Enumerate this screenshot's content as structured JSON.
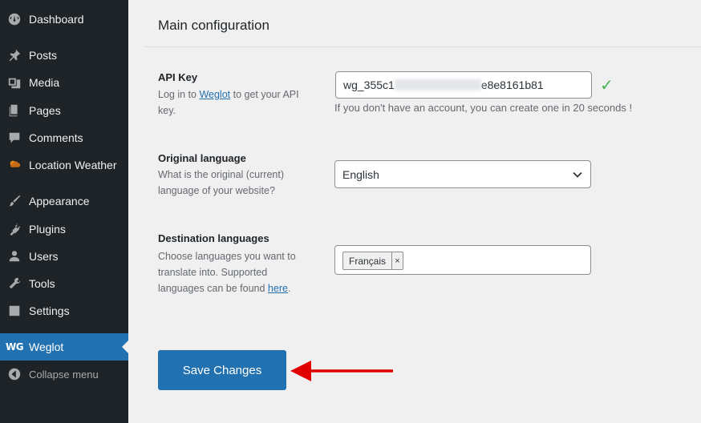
{
  "sidebar": {
    "items": [
      {
        "label": "Dashboard",
        "icon": "dashboard-icon"
      },
      {
        "label": "Posts",
        "icon": "pushpin-icon"
      },
      {
        "label": "Media",
        "icon": "media-icon"
      },
      {
        "label": "Pages",
        "icon": "pages-icon"
      },
      {
        "label": "Comments",
        "icon": "comment-icon"
      },
      {
        "label": "Location Weather",
        "icon": "weather-icon"
      },
      {
        "label": "Appearance",
        "icon": "paintbrush-icon"
      },
      {
        "label": "Plugins",
        "icon": "plugin-icon"
      },
      {
        "label": "Users",
        "icon": "users-icon"
      },
      {
        "label": "Tools",
        "icon": "wrench-icon"
      },
      {
        "label": "Settings",
        "icon": "settings-icon"
      },
      {
        "label": "Weglot",
        "icon": "weglot-logo-icon",
        "logo_text": "WG",
        "active": true
      },
      {
        "label": "Collapse menu",
        "icon": "collapse-icon"
      }
    ]
  },
  "main": {
    "title": "Main configuration",
    "api_key": {
      "label": "API Key",
      "desc_before": "Log in to ",
      "desc_link": "Weglot",
      "desc_after": " to get your API key.",
      "value_start": "wg_355c1",
      "value_end": "e8e8161b81",
      "hint": "If you don't have an account, you can create one in 20 seconds !"
    },
    "original_language": {
      "label": "Original language",
      "desc": "What is the original (current) language of your website?",
      "selected": "English"
    },
    "destination_languages": {
      "label": "Destination languages",
      "desc_before": "Choose languages you want to translate into. Supported languages can be found ",
      "desc_link": "here",
      "desc_after": ".",
      "tags": [
        "Français"
      ],
      "remove_glyph": "×"
    },
    "save_label": "Save Changes",
    "accent_color": "#2271b1",
    "arrow_color": "#e00000",
    "check_color": "#46b450"
  }
}
